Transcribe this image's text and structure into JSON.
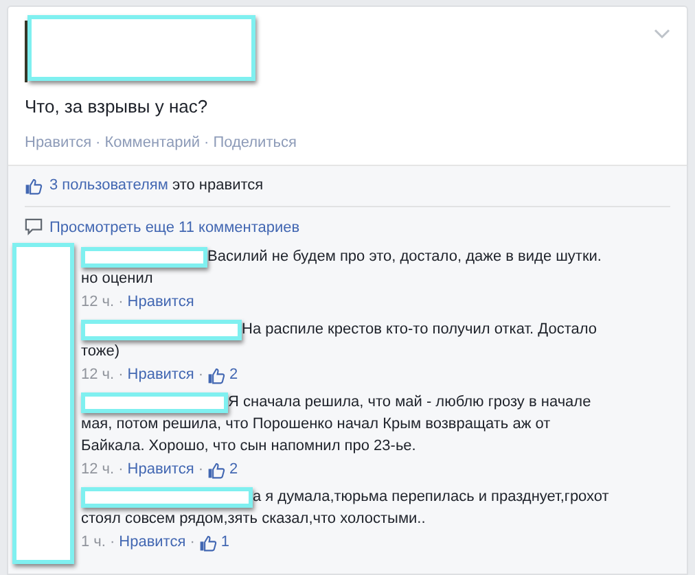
{
  "post": {
    "text": "Что, за взрывы у нас?",
    "actions": [
      "Нравится",
      "Комментарий",
      "Поделиться"
    ]
  },
  "likes_summary": {
    "link": "3 пользователям",
    "rest": "это нравится"
  },
  "separator": "·",
  "more_comments": "Просмотреть еще 11 комментариев",
  "comments": [
    {
      "text": "Василий не будем про это, достало, даже в виде шутки. но оценил",
      "time": "12 ч.",
      "like": "Нравится"
    },
    {
      "text": "На распиле крестов кто-то получил откат. Достало тоже)",
      "time": "12 ч.",
      "like": "Нравится",
      "likes": "2"
    },
    {
      "text": "Я сначала решила, что май - люблю грозу в начале мая, потом решила, что Порошенко начал Крым возвращать аж от Байкала. Хорошо, что сын напомнил про 23-ье.",
      "time": "12 ч.",
      "like": "Нравится",
      "likes": "2"
    },
    {
      "text": "а я думала,тюрьма перепилась и празднует,грохот стоял совсем рядом,зять сказал,что холостыми..",
      "time": "1 ч.",
      "like": "Нравится",
      "likes": "1"
    }
  ]
}
